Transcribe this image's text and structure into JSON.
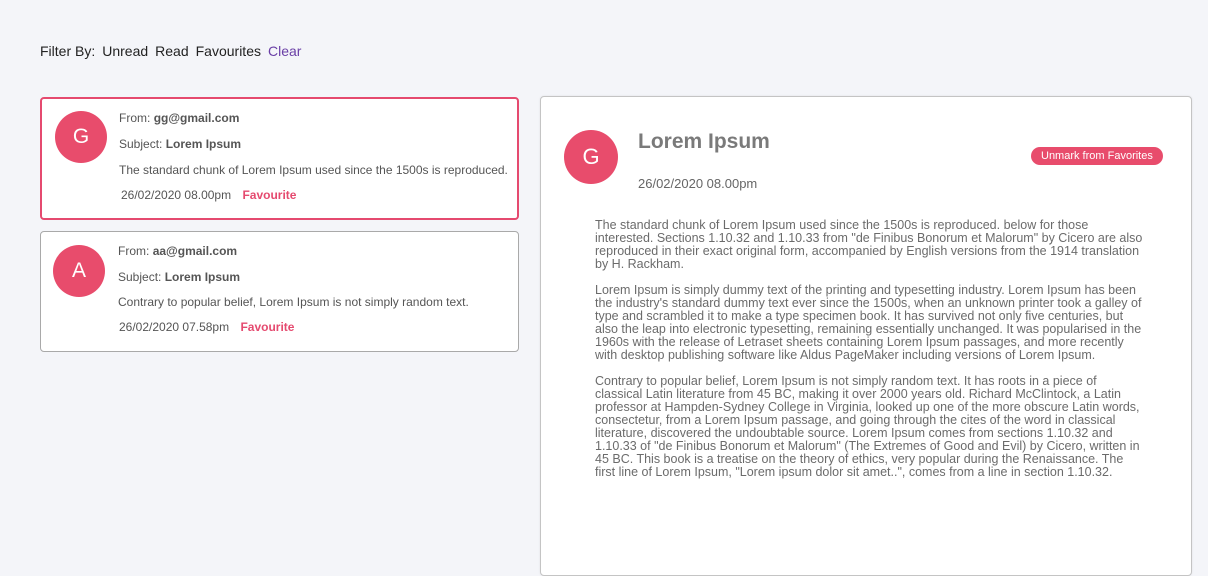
{
  "filter": {
    "label": "Filter By:",
    "options": [
      "Unread",
      "Read",
      "Favourites"
    ],
    "clear": "Clear"
  },
  "emails": [
    {
      "avatar": "G",
      "from_label": "From:",
      "from": "gg@gmail.com",
      "subject_label": "Subject:",
      "subject": "Lorem Ipsum",
      "snippet": "The standard chunk of Lorem Ipsum used since the 1500s is reproduced.",
      "date": "26/02/2020 08.00pm",
      "favourite": "Favourite"
    },
    {
      "avatar": "A",
      "from_label": "From:",
      "from": "aa@gmail.com",
      "subject_label": "Subject:",
      "subject": "Lorem Ipsum",
      "snippet": "Contrary to popular belief, Lorem Ipsum is not simply random text.",
      "date": "26/02/2020 07.58pm",
      "favourite": "Favourite"
    }
  ],
  "detail": {
    "avatar": "G",
    "subject": "Lorem Ipsum",
    "date": "26/02/2020 08.00pm",
    "unmark_label": "Unmark from Favorites",
    "paragraphs": [
      "The standard chunk of Lorem Ipsum used since the 1500s is reproduced. below for those interested. Sections 1.10.32 and 1.10.33 from \"de Finibus Bonorum et Malorum\" by Cicero are also reproduced in their exact original form, accompanied by English versions from the 1914 translation by H. Rackham.",
      "Lorem Ipsum is simply dummy text of the printing and typesetting industry. Lorem Ipsum has been the industry's standard dummy text ever since the 1500s, when an unknown printer took a galley of type and scrambled it to make a type specimen book. It has survived not only five centuries, but also the leap into electronic typesetting, remaining essentially unchanged. It was popularised in the 1960s with the release of Letraset sheets containing Lorem Ipsum passages, and more recently with desktop publishing software like Aldus PageMaker including versions of Lorem Ipsum.",
      "Contrary to popular belief, Lorem Ipsum is not simply random text. It has roots in a piece of classical Latin literature from 45 BC, making it over 2000 years old. Richard McClintock, a Latin professor at Hampden-Sydney College in Virginia, looked up one of the more obscure Latin words, consectetur, from a Lorem Ipsum passage, and going through the cites of the word in classical literature, discovered the undoubtable source. Lorem Ipsum comes from sections 1.10.32 and 1.10.33 of \"de Finibus Bonorum et Malorum\" (The Extremes of Good and Evil) by Cicero, written in 45 BC. This book is a treatise on the theory of ethics, very popular during the Renaissance. The first line of Lorem Ipsum, \"Lorem ipsum dolor sit amet..\", comes from a line in section 1.10.32."
    ]
  },
  "colors": {
    "accent": "#e84c6c",
    "clear_link": "#6a3fa6",
    "background": "#f4f5f9"
  }
}
